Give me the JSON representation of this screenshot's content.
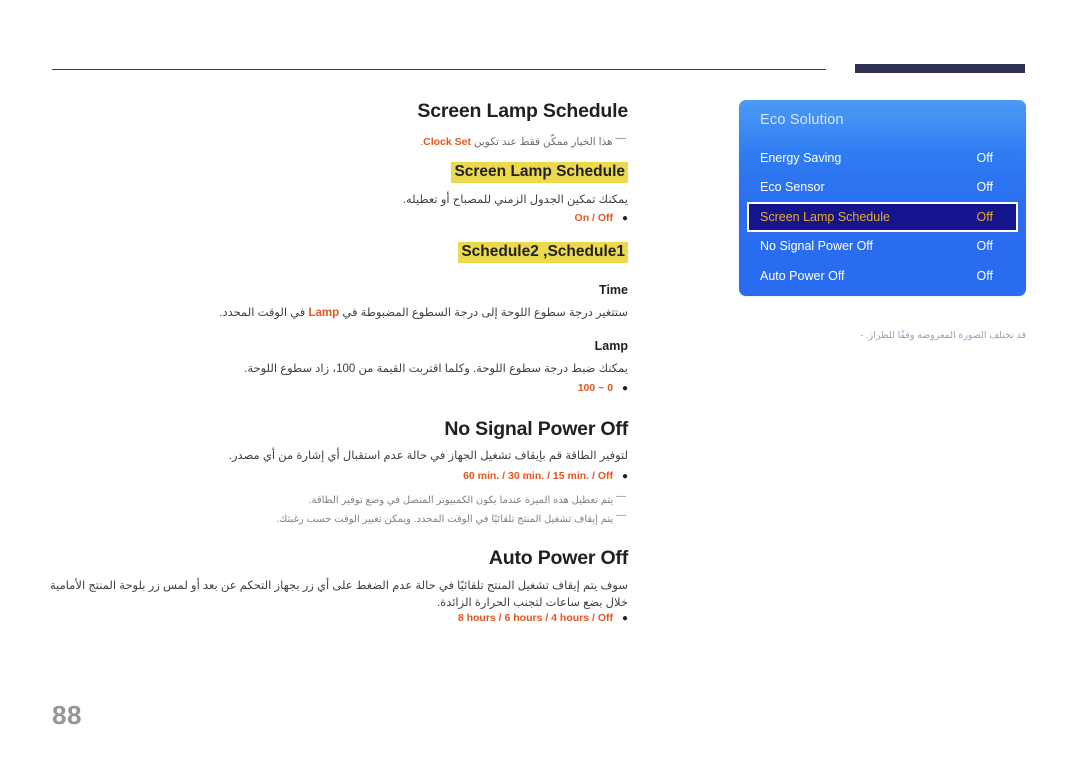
{
  "page": {
    "number": "88"
  },
  "sections": [
    {
      "id": "screen-lamp-schedule",
      "title": "Screen Lamp Schedule",
      "note": "هذا الخيار ممكّن فقط عند تكوين",
      "note_term": "Clock Set",
      "note_tail": ".",
      "highlight1": "Screen Lamp Schedule",
      "desc1": "يمكنك تمكين الجدول الزمني للمصباح أو تعطيله.",
      "options1": "On / Off",
      "highlight2": "Schedule2 ,Schedule1",
      "sub1": "Time",
      "sub1_desc_pre": "ستتغير درجة سطوع اللوحة إلى درجة السطوع المضبوطة في",
      "sub1_desc_term": "Lamp",
      "sub1_desc_post": "في الوقت المحدد.",
      "sub2": "Lamp",
      "sub2_desc": "يمكنك ضبط درجة سطوع اللوحة. وكلما اقتربت القيمة من 100، زاد سطوع اللوحة.",
      "options2": "100 ~ 0"
    },
    {
      "id": "no-signal-power-off",
      "title": "No Signal Power Off",
      "desc": "لتوفير الطاقة قم بإيقاف تشغيل الجهاز في حالة عدم استقبال أي إشارة من أي مصدر.",
      "options": "60 min. / 30 min. / 15 min. / Off",
      "footnotes": [
        "يتم تعطيل هذه الميزة عندما يكون الكمبيوتر المتصل في وضع توفير الطاقة.",
        "يتم إيقاف تشغيل المنتج تلقائيًا في الوقت المحدد. ويمكن تغيير الوقت حسب رغبتك."
      ]
    },
    {
      "id": "auto-power-off",
      "title": "Auto Power Off",
      "desc": "سوف يتم إيقاف تشغيل المنتج تلقائيًا في حالة عدم الضغط على أي زر بجهاز التحكم عن بعد أو لمس زر بلوحة المنتج الأمامية خلال بضع ساعات لتجنب الحرارة الزائدة.",
      "options": "8 hours / 6 hours / 4 hours / Off"
    }
  ],
  "osd": {
    "title": "Eco Solution",
    "rows": [
      {
        "label": "Energy Saving",
        "value": "Off",
        "selected": false
      },
      {
        "label": "Eco Sensor",
        "value": "Off",
        "selected": false
      },
      {
        "label": "Screen Lamp Schedule",
        "value": "Off",
        "selected": true
      },
      {
        "label": "No Signal Power Off",
        "value": "Off",
        "selected": false
      },
      {
        "label": "Auto Power Off",
        "value": "Off",
        "selected": false
      }
    ],
    "caption_dash": "-",
    "caption": "قد تختلف الصورة المعروضة وفقًا للطراز."
  },
  "colors": {
    "accent_orange": "#e8541f",
    "highlight_yellow": "#ebd94e",
    "osd_blue": "#2a6cf0",
    "osd_selected": "#14148c",
    "osd_selected_text": "#f0a828",
    "rule_navy": "#2f3154",
    "page_num_gray": "#939598"
  }
}
